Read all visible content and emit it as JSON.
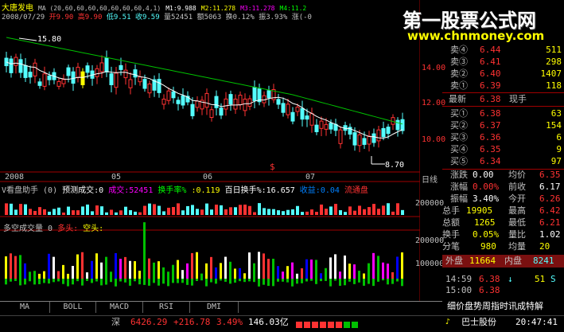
{
  "stock": {
    "name": "大唐发电",
    "date_value": "2008/07/29"
  },
  "ma_header": {
    "title": "MA (20,60,60,60,60,60,60,60,4,1)",
    "m1": "M1:9.988",
    "m2": "M2:11.278",
    "m3": "M3:11.278",
    "m4": "M4:11.2"
  },
  "ohlc_header": {
    "open": "开9.90",
    "high": "高9.90",
    "low": "低9.51",
    "close": "收9.59",
    "volume": "量52451",
    "amount": "额5063",
    "turnover": "换0.12%",
    "amplitude": "振3.93%",
    "change": "涨(-0"
  },
  "price_axis": {
    "labels": [
      "14.00",
      "12.00",
      "10.00"
    ]
  },
  "annotations": {
    "high_mark": "15.80",
    "low_mark": "8.70",
    "signal_glyph": "$"
  },
  "date_axis": {
    "labels": [
      "2008",
      "05",
      "06",
      "07"
    ],
    "period": "日线"
  },
  "panel2": {
    "title": "V看盘助手 (0)",
    "predicted": "预测成交:0",
    "volume": "成交:52451",
    "turnover_ratio": "换手率%",
    "turnover_value": ":0.119",
    "hundred_day": "百日换手%:16.657",
    "profit": "收益:0.04",
    "outflow": "流通盘",
    "axis_label": "200000"
  },
  "panel3": {
    "title": "多空成交量 0",
    "bull": "多头:",
    "bear": "空头:",
    "axis_labels": [
      "200000",
      "100000"
    ]
  },
  "watermark": {
    "line1": "第一股票公式网",
    "line2": "www.chnmoney.com"
  },
  "order_book": {
    "asks": [
      {
        "label": "卖④",
        "price": "6.44",
        "vol": "511"
      },
      {
        "label": "卖③",
        "price": "6.41",
        "vol": "298"
      },
      {
        "label": "卖②",
        "price": "6.40",
        "vol": "1407"
      },
      {
        "label": "卖①",
        "price": "6.39",
        "vol": "118"
      }
    ],
    "last": {
      "label": "最新",
      "price": "6.38",
      "tag": "现手"
    },
    "bids": [
      {
        "label": "买①",
        "price": "6.38",
        "vol": "63"
      },
      {
        "label": "买②",
        "price": "6.37",
        "vol": "154"
      },
      {
        "label": "买③",
        "price": "6.36",
        "vol": "6"
      },
      {
        "label": "买④",
        "price": "6.35",
        "vol": "9"
      },
      {
        "label": "买⑤",
        "price": "6.34",
        "vol": "97"
      }
    ]
  },
  "stats": [
    {
      "l1": "涨跌",
      "v1": "0.00",
      "l2": "均价",
      "v2": "6.35"
    },
    {
      "l1": "涨幅",
      "v1": "0.00%",
      "l2": "前收",
      "v2": "6.17"
    },
    {
      "l1": "振幅",
      "v1": "3.40%",
      "l2": "今开",
      "v2": "6.26"
    },
    {
      "l1": "总手",
      "v1": "19905",
      "l2": "最高",
      "v2": "6.42"
    },
    {
      "l1": "总额",
      "v1": "1265",
      "l2": "最低",
      "v2": "6.21"
    },
    {
      "l1": "换手",
      "v1": "0.05%",
      "l2": "量比",
      "v2": "1.02"
    },
    {
      "l1": "分笔",
      "v1": "980",
      "l2": "均量",
      "v2": "20"
    }
  ],
  "outer_inner": {
    "outer_label": "外盘",
    "outer_value": "11664",
    "inner_label": "内盘",
    "inner_value": "8241"
  },
  "tick": {
    "time": "14:59",
    "price": "6.38",
    "vol": "51",
    "side": "S"
  },
  "tick2": {
    "time": "15:00",
    "price": "6.38"
  },
  "news_text": "细价盘势周指时讯成特解",
  "tabs": [
    "MA",
    "BOLL",
    "MACD",
    "RSI",
    "DMI"
  ],
  "status": {
    "index_name": "深",
    "index_value": "6426.29",
    "index_change": "+216.78",
    "index_pct": "3.49%",
    "index_amount": "146.03亿",
    "right_text": "巴士股份",
    "time": "20:47:41"
  },
  "colors": {
    "up": "#ff3232",
    "down": "#54ffff",
    "ma1": "#ffffff",
    "ma2": "#00c000",
    "yellow": "#ffff00",
    "magenta": "#ff00ff",
    "bg": "#000000",
    "grid": "#800000"
  }
}
